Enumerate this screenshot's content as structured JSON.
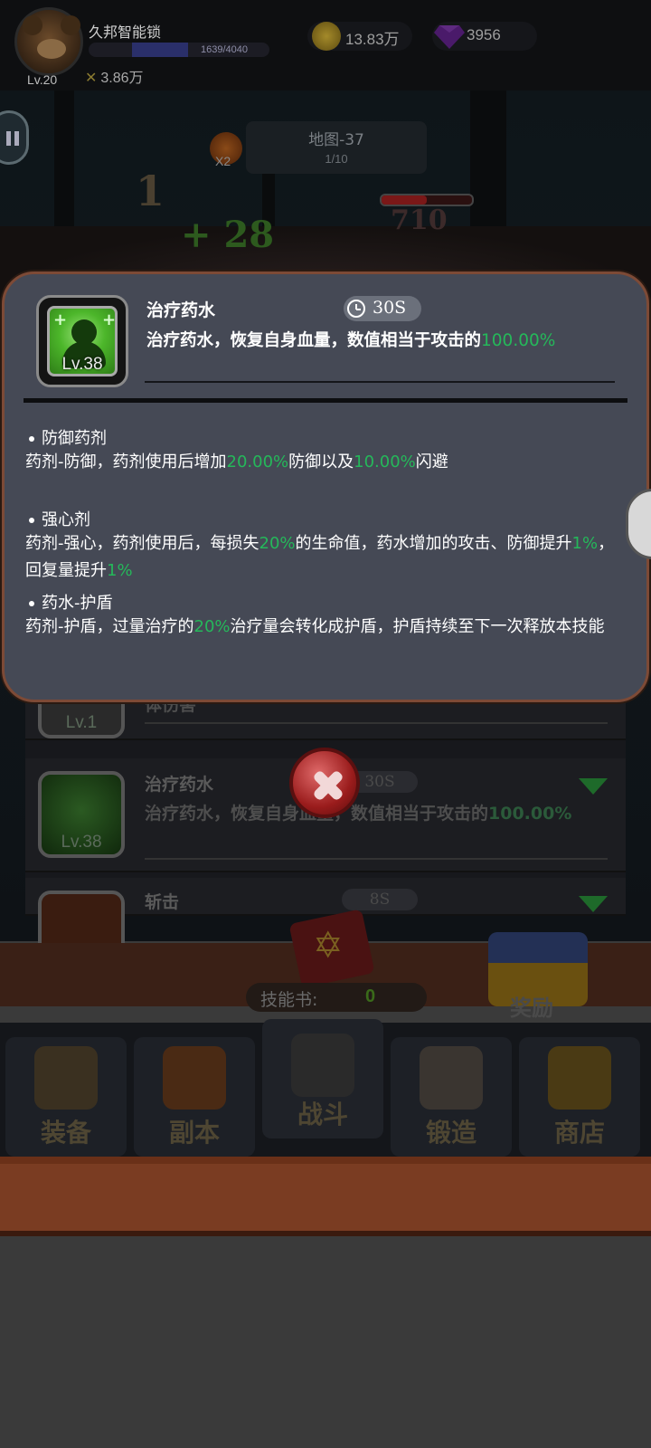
{
  "hud": {
    "player_name": "久邦智能锁",
    "level": "Lv.20",
    "xp": "1639/4040",
    "xp_fraction": 0.41,
    "power": "3.86万",
    "gold": "13.83万",
    "gems": "3956"
  },
  "battle": {
    "speed": "X2",
    "map_title": "地图-37",
    "map_progress": "1/10",
    "damage_text": "1",
    "heal_text": "+ 28",
    "enemy_hp": "710"
  },
  "popup": {
    "skill_name": "治疗药水",
    "cooldown": "30S",
    "level": "Lv.38",
    "desc_prefix": "治疗药水，恢复自身血量，数值相当于攻击的",
    "desc_pct": "100.00%",
    "sections": [
      {
        "title": "防御药剂",
        "parts": [
          "药剂-防御，药剂使用后增加",
          "20.00%",
          "防御以及",
          "10.00%",
          "闪避"
        ]
      },
      {
        "title": "强心剂",
        "parts": [
          "药剂-强心，药剂使用后，每损失",
          "20%",
          "的生命值，药水增加的攻击、防御提升",
          "1%",
          "，回复量提升",
          "1%"
        ]
      },
      {
        "title": "药水-护盾",
        "parts": [
          "药剂-护盾，过量治疗的",
          "20%",
          "治疗量会转化成护盾，护盾持续至下一次释放本技能"
        ]
      }
    ]
  },
  "skill_list": [
    {
      "name": "",
      "level": "Lv.1",
      "desc": "体伤害"
    },
    {
      "name": "治疗药水",
      "level": "Lv.38",
      "cooldown": "30S",
      "desc_prefix": "治疗药水，恢复自身血量，数值相当于攻击的",
      "desc_pct": "100.00%"
    },
    {
      "name": "斩击",
      "cooldown": "8S"
    }
  ],
  "bottom": {
    "skillbook_label": "技能书:",
    "skillbook_count": "0",
    "reward_label": "奖励"
  },
  "nav": [
    {
      "label": "装备"
    },
    {
      "label": "副本"
    },
    {
      "label": "战斗"
    },
    {
      "label": "锻造"
    },
    {
      "label": "商店"
    }
  ]
}
